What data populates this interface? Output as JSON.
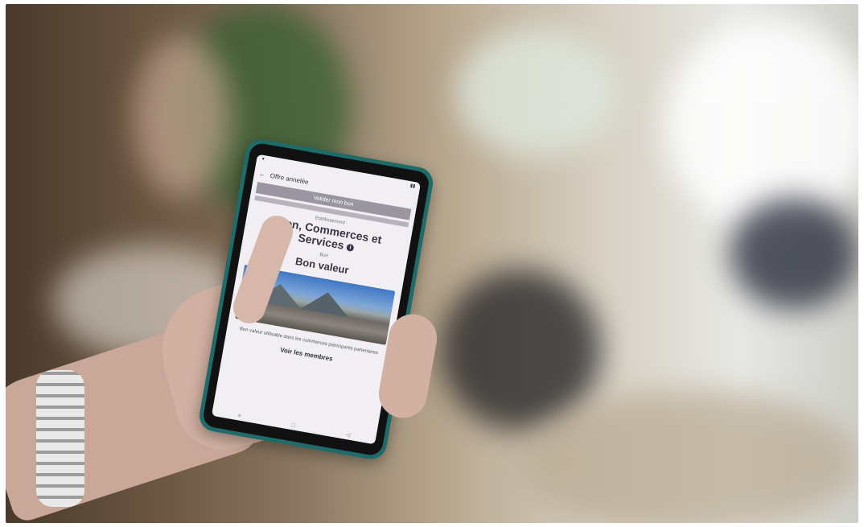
{
  "phone": {
    "appbar_title": "Offre annelée",
    "banner_text": "Valider mon bon",
    "merchant_prefix": "Etablissement",
    "merchant_name": "Sion, Commerces et Services",
    "offer_prefix": "Bon",
    "offer_name": "Bon valeur",
    "body_text": "Bon valeur utilisable dans les commerces participants partenaires",
    "link_text": "Voir les membres",
    "info_glyph": "i"
  },
  "colors": {
    "phone_case": "#1f6b69",
    "screen_bg": "#f2eff4",
    "banner": "#9a96a1"
  }
}
